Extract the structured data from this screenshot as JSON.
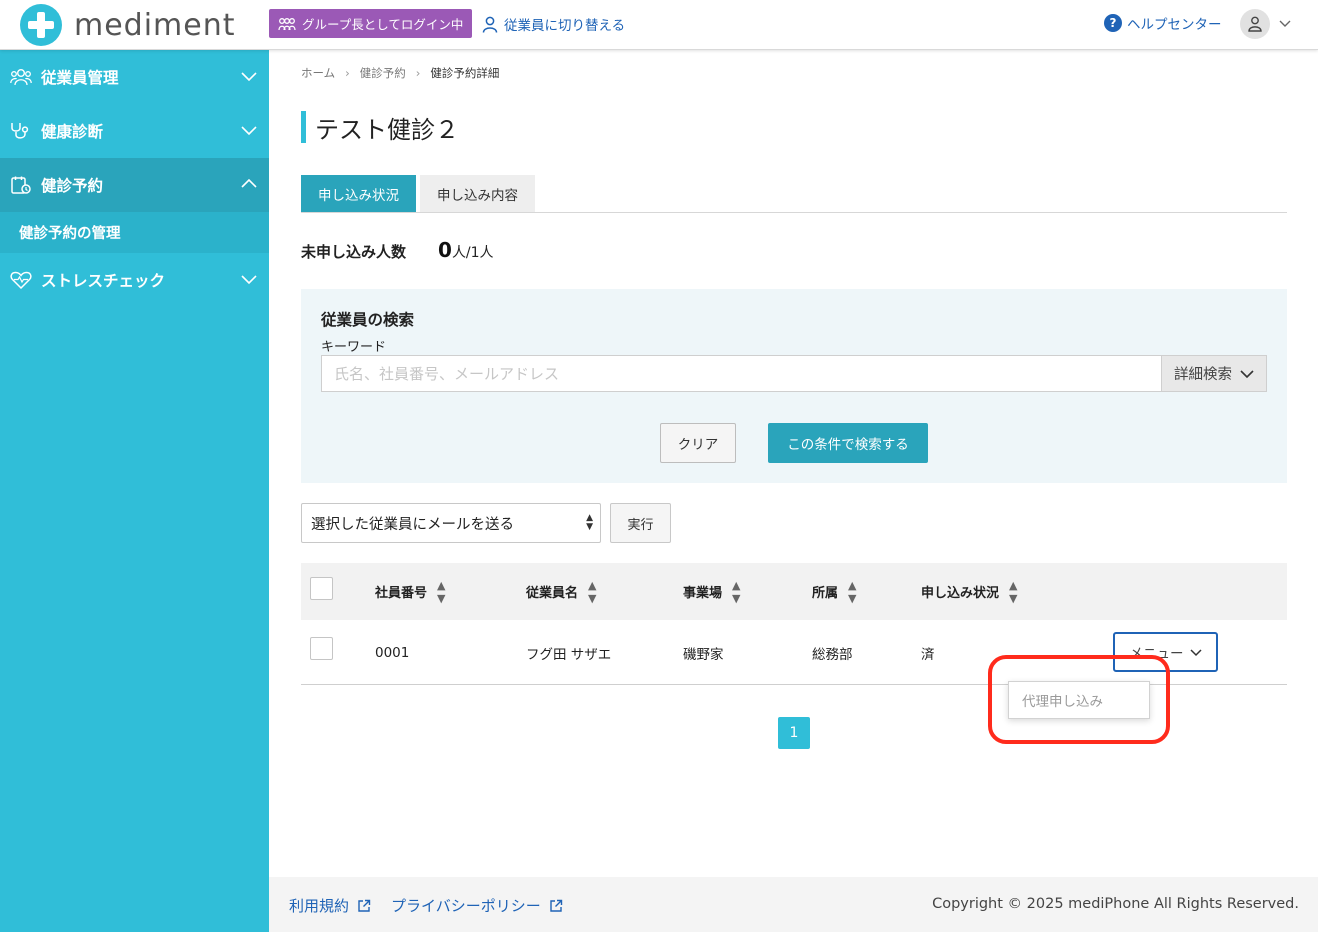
{
  "app": {
    "brand": "mediment"
  },
  "header": {
    "group_badge": "グループ長としてログイン中",
    "switch_link": "従業員に切り替える",
    "help": "ヘルプセンター"
  },
  "sidebar": {
    "items": [
      {
        "label": "従業員管理",
        "icon": "people-icon"
      },
      {
        "label": "健康診断",
        "icon": "stethoscope-icon"
      },
      {
        "label": "健診予約",
        "icon": "calendar-clipboard-icon"
      },
      {
        "label": "ストレスチェック",
        "icon": "heart-icon"
      }
    ],
    "subitem": "健診予約の管理"
  },
  "breadcrumb": {
    "home": "ホーム",
    "parent": "健診予約",
    "current": "健診予約詳細"
  },
  "page": {
    "title": "テスト健診２"
  },
  "tabs": [
    {
      "label": "申し込み状況",
      "active": true
    },
    {
      "label": "申し込み内容",
      "active": false
    }
  ],
  "stats": {
    "label": "未申し込み人数",
    "count": "0",
    "suffix": "人/1人"
  },
  "search": {
    "title": "従業員の検索",
    "keyword_label": "キーワード",
    "placeholder": "氏名、社員番号、メールアドレス",
    "advanced_label": "詳細検索",
    "clear_label": "クリア",
    "submit_label": "この条件で検索する"
  },
  "bulk": {
    "selected": "選択した従業員にメールを送る",
    "exec_label": "実行"
  },
  "table": {
    "headers": [
      "社員番号",
      "従業員名",
      "事業場",
      "所属",
      "申し込み状況"
    ],
    "rows": [
      {
        "employee_id": "0001",
        "name": "フグ田 サザエ",
        "site": "磯野家",
        "dept": "総務部",
        "status": "済",
        "menu": "メニュー"
      }
    ]
  },
  "menu_dropdown": {
    "item": "代理申し込み"
  },
  "pagination": {
    "current": "1"
  },
  "footer": {
    "terms": "利用規約",
    "privacy": "プライバシーポリシー",
    "copyright": "Copyright © 2025 mediPhone All Rights Reserved."
  },
  "colors": {
    "primary": "#30bed8",
    "primary_dark": "#2aa4bb",
    "link": "#1f63b6",
    "badge": "#9b59b6",
    "highlight": "#ff2b1c"
  }
}
